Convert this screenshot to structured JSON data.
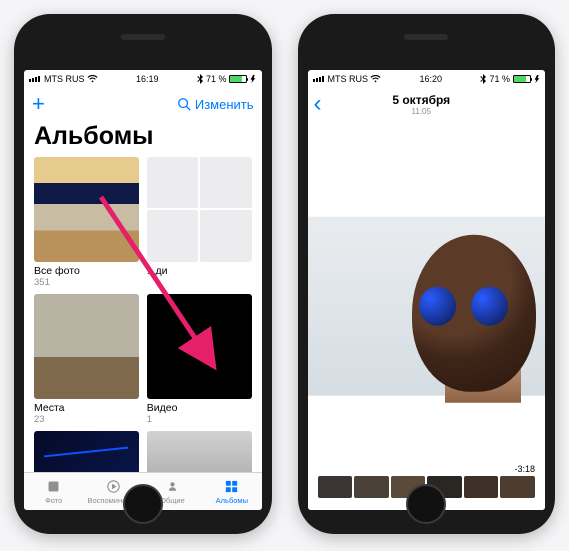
{
  "colors": {
    "accent": "#007aff",
    "battery": "#4cd964"
  },
  "screen1": {
    "status": {
      "carrier": "MTS RUS",
      "time": "16:19",
      "bt": "᛭",
      "pct": "71 %"
    },
    "nav": {
      "plus": "+",
      "edit": "Изменить",
      "search_icon": "search-icon"
    },
    "title": "Альбомы",
    "albums": [
      {
        "title": "Все фото",
        "count": "351"
      },
      {
        "title": "...ди",
        "count": ""
      },
      {
        "title": "Места",
        "count": "23"
      },
      {
        "title": "Видео",
        "count": "1"
      }
    ],
    "tabs": [
      {
        "label": "Фото",
        "active": false
      },
      {
        "label": "Воспоминания",
        "active": false
      },
      {
        "label": "Общие",
        "active": false
      },
      {
        "label": "Альбомы",
        "active": true
      }
    ]
  },
  "screen2": {
    "status": {
      "carrier": "MTS RUS",
      "time": "16:20",
      "bt": "᛭",
      "pct": "71 %"
    },
    "nav": {
      "back": "‹",
      "title": "5 октября",
      "subtitle": "11:05"
    },
    "player": {
      "remaining": "-3:18",
      "pause": "❚❚"
    }
  }
}
